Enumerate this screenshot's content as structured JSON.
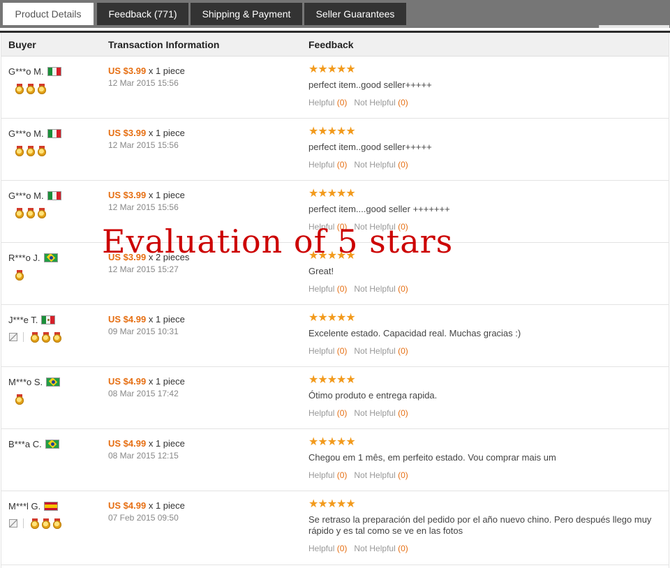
{
  "tabs": [
    {
      "label": "Product Details",
      "active": true
    },
    {
      "label": "Feedback (771)",
      "active": false
    },
    {
      "label": "Shipping & Payment",
      "active": false
    },
    {
      "label": "Seller Guarantees",
      "active": false
    }
  ],
  "table": {
    "headers": {
      "buyer": "Buyer",
      "transaction": "Transaction Information",
      "feedback": "Feedback"
    },
    "rows": [
      {
        "buyer": "G***o M.",
        "country": "italy-flag",
        "price": "US $3.99",
        "qty": "x 1 piece",
        "date": "12 Mar 2015 15:56",
        "stars": "★★★★★",
        "comment": "perfect item..good seller+++++",
        "helpful_label": "Helpful",
        "helpful_count": "(0)",
        "not_helpful_label": "Not Helpful",
        "not_helpful_count": "(0)"
      },
      {
        "buyer": "G***o M.",
        "country": "italy-flag",
        "price": "US $3.99",
        "qty": "x 1 piece",
        "date": "12 Mar 2015 15:56",
        "stars": "★★★★★",
        "comment": "perfect item..good seller+++++",
        "helpful_label": "Helpful",
        "helpful_count": "(0)",
        "not_helpful_label": "Not Helpful",
        "not_helpful_count": "(0)"
      },
      {
        "buyer": "G***o M.",
        "country": "italy-flag",
        "price": "US $3.99",
        "qty": "x 1 piece",
        "date": "12 Mar 2015 15:56",
        "stars": "★★★★★",
        "comment": "perfect item....good seller +++++++",
        "helpful_label": "Helpful",
        "helpful_count": "(0)",
        "not_helpful_label": "Not Helpful",
        "not_helpful_count": "(0)"
      },
      {
        "buyer": "R***o J.",
        "country": "brazil-flag",
        "price": "US $3.99",
        "qty": "x 2 pieces",
        "date": "12 Mar 2015 15:27",
        "stars": "★★★★★",
        "comment": "Great!",
        "helpful_label": "Helpful",
        "helpful_count": "(0)",
        "not_helpful_label": "Not Helpful",
        "not_helpful_count": "(0)"
      },
      {
        "buyer": "J***e T.",
        "country": "mexico-flag",
        "price": "US $4.99",
        "qty": "x 1 piece",
        "date": "09 Mar 2015 10:31",
        "stars": "★★★★★",
        "comment": "Excelente estado. Capacidad real. Muchas gracias :)",
        "helpful_label": "Helpful",
        "helpful_count": "(0)",
        "not_helpful_label": "Not Helpful",
        "not_helpful_count": "(0)"
      },
      {
        "buyer": "M***o S.",
        "country": "brazil-flag",
        "price": "US $4.99",
        "qty": "x 1 piece",
        "date": "08 Mar 2015 17:42",
        "stars": "★★★★★",
        "comment": "Ótimo produto e entrega rapida.",
        "helpful_label": "Helpful",
        "helpful_count": "(0)",
        "not_helpful_label": "Not Helpful",
        "not_helpful_count": "(0)"
      },
      {
        "buyer": "B***a C.",
        "country": "brazil-flag",
        "price": "US $4.99",
        "qty": "x 1 piece",
        "date": "08 Mar 2015 12:15",
        "stars": "★★★★★",
        "comment": "Chegou em 1 mês, em perfeito estado. Vou comprar mais um",
        "helpful_label": "Helpful",
        "helpful_count": "(0)",
        "not_helpful_label": "Not Helpful",
        "not_helpful_count": "(0)"
      },
      {
        "buyer": "M***l G.",
        "country": "spain-flag",
        "price": "US $4.99",
        "qty": "x 1 piece",
        "date": "07 Feb 2015 09:50",
        "stars": "★★★★★",
        "comment": "Se retraso la preparación del pedido por el año nuevo chino. Pero después llego muy rápido y es tal como se ve en las fotos",
        "helpful_label": "Helpful",
        "helpful_count": "(0)",
        "not_helpful_label": "Not Helpful",
        "not_helpful_count": "(0)"
      }
    ]
  },
  "overlay_text": "Evaluation of 5 stars",
  "colors": {
    "price": "#e66f13",
    "star": "#f29a1c",
    "tab_bg": "#333333",
    "tabbar_bg": "#767676",
    "overlay": "#cc0000"
  }
}
